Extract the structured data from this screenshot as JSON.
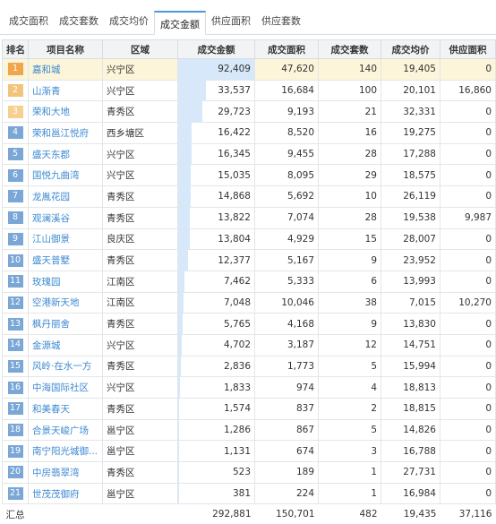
{
  "tabs": [
    {
      "label": "成交面积",
      "active": false
    },
    {
      "label": "成交套数",
      "active": false
    },
    {
      "label": "成交均价",
      "active": false
    },
    {
      "label": "成交金额",
      "active": true
    },
    {
      "label": "供应面积",
      "active": false
    },
    {
      "label": "供应套数",
      "active": false
    }
  ],
  "columns": [
    "排名",
    "项目名称",
    "区域",
    "成交金额",
    "成交面积",
    "成交套数",
    "成交均价",
    "供应面积"
  ],
  "rows": [
    {
      "rank": "1",
      "name": "嘉和城",
      "area": "兴宁区",
      "amount": "92,409",
      "amount_value": 92409,
      "deal_area": "47,620",
      "units": "140",
      "avg_price": "19,405",
      "supply_area": "0"
    },
    {
      "rank": "2",
      "name": "山渐青",
      "area": "兴宁区",
      "amount": "33,537",
      "amount_value": 33537,
      "deal_area": "16,684",
      "units": "100",
      "avg_price": "20,101",
      "supply_area": "16,860"
    },
    {
      "rank": "3",
      "name": "荣和大地",
      "area": "青秀区",
      "amount": "29,723",
      "amount_value": 29723,
      "deal_area": "9,193",
      "units": "21",
      "avg_price": "32,331",
      "supply_area": "0"
    },
    {
      "rank": "4",
      "name": "荣和邕江悦府",
      "area": "西乡塘区",
      "amount": "16,422",
      "amount_value": 16422,
      "deal_area": "8,520",
      "units": "16",
      "avg_price": "19,275",
      "supply_area": "0"
    },
    {
      "rank": "5",
      "name": "盛天东郡",
      "area": "兴宁区",
      "amount": "16,345",
      "amount_value": 16345,
      "deal_area": "9,455",
      "units": "28",
      "avg_price": "17,288",
      "supply_area": "0"
    },
    {
      "rank": "6",
      "name": "国悦九曲湾",
      "area": "兴宁区",
      "amount": "15,035",
      "amount_value": 15035,
      "deal_area": "8,095",
      "units": "29",
      "avg_price": "18,575",
      "supply_area": "0"
    },
    {
      "rank": "7",
      "name": "龙胤花园",
      "area": "青秀区",
      "amount": "14,868",
      "amount_value": 14868,
      "deal_area": "5,692",
      "units": "10",
      "avg_price": "26,119",
      "supply_area": "0"
    },
    {
      "rank": "8",
      "name": "观澜溪谷",
      "area": "青秀区",
      "amount": "13,822",
      "amount_value": 13822,
      "deal_area": "7,074",
      "units": "28",
      "avg_price": "19,538",
      "supply_area": "9,987"
    },
    {
      "rank": "9",
      "name": "江山御景",
      "area": "良庆区",
      "amount": "13,804",
      "amount_value": 13804,
      "deal_area": "4,929",
      "units": "15",
      "avg_price": "28,007",
      "supply_area": "0"
    },
    {
      "rank": "10",
      "name": "盛天普墅",
      "area": "青秀区",
      "amount": "12,377",
      "amount_value": 12377,
      "deal_area": "5,167",
      "units": "9",
      "avg_price": "23,952",
      "supply_area": "0"
    },
    {
      "rank": "11",
      "name": "玫瑰园",
      "area": "江南区",
      "amount": "7,462",
      "amount_value": 7462,
      "deal_area": "5,333",
      "units": "6",
      "avg_price": "13,993",
      "supply_area": "0"
    },
    {
      "rank": "12",
      "name": "空港新天地",
      "area": "江南区",
      "amount": "7,048",
      "amount_value": 7048,
      "deal_area": "10,046",
      "units": "38",
      "avg_price": "7,015",
      "supply_area": "10,270"
    },
    {
      "rank": "13",
      "name": "枫丹丽舍",
      "area": "青秀区",
      "amount": "5,765",
      "amount_value": 5765,
      "deal_area": "4,168",
      "units": "9",
      "avg_price": "13,830",
      "supply_area": "0"
    },
    {
      "rank": "14",
      "name": "金源城",
      "area": "兴宁区",
      "amount": "4,702",
      "amount_value": 4702,
      "deal_area": "3,187",
      "units": "12",
      "avg_price": "14,751",
      "supply_area": "0"
    },
    {
      "rank": "15",
      "name": "风岭·在水一方",
      "area": "青秀区",
      "amount": "2,836",
      "amount_value": 2836,
      "deal_area": "1,773",
      "units": "5",
      "avg_price": "15,994",
      "supply_area": "0"
    },
    {
      "rank": "16",
      "name": "中海国际社区",
      "area": "兴宁区",
      "amount": "1,833",
      "amount_value": 1833,
      "deal_area": "974",
      "units": "4",
      "avg_price": "18,813",
      "supply_area": "0"
    },
    {
      "rank": "17",
      "name": "和美春天",
      "area": "青秀区",
      "amount": "1,574",
      "amount_value": 1574,
      "deal_area": "837",
      "units": "2",
      "avg_price": "18,815",
      "supply_area": "0"
    },
    {
      "rank": "18",
      "name": "合景天峻广场",
      "area": "邕宁区",
      "amount": "1,286",
      "amount_value": 1286,
      "deal_area": "867",
      "units": "5",
      "avg_price": "14,826",
      "supply_area": "0"
    },
    {
      "rank": "19",
      "name": "南宁阳光城御...",
      "area": "邕宁区",
      "amount": "1,131",
      "amount_value": 1131,
      "deal_area": "674",
      "units": "3",
      "avg_price": "16,788",
      "supply_area": "0"
    },
    {
      "rank": "20",
      "name": "中房翡翠湾",
      "area": "青秀区",
      "amount": "523",
      "amount_value": 523,
      "deal_area": "189",
      "units": "1",
      "avg_price": "27,731",
      "supply_area": "0"
    },
    {
      "rank": "21",
      "name": "世茂茂御府",
      "area": "邕宁区",
      "amount": "381",
      "amount_value": 381,
      "deal_area": "224",
      "units": "1",
      "avg_price": "16,984",
      "supply_area": "0"
    }
  ],
  "totals": {
    "label": "汇总",
    "amount": "292,881",
    "deal_area": "150,701",
    "units": "482",
    "avg_price": "19,435",
    "supply_area": "37,116"
  },
  "colors": {
    "accent": "#4d97d8",
    "bar": "#d6e8f9",
    "highlight_row": "#fdf5d9",
    "link_text": "#3d8ad1"
  }
}
